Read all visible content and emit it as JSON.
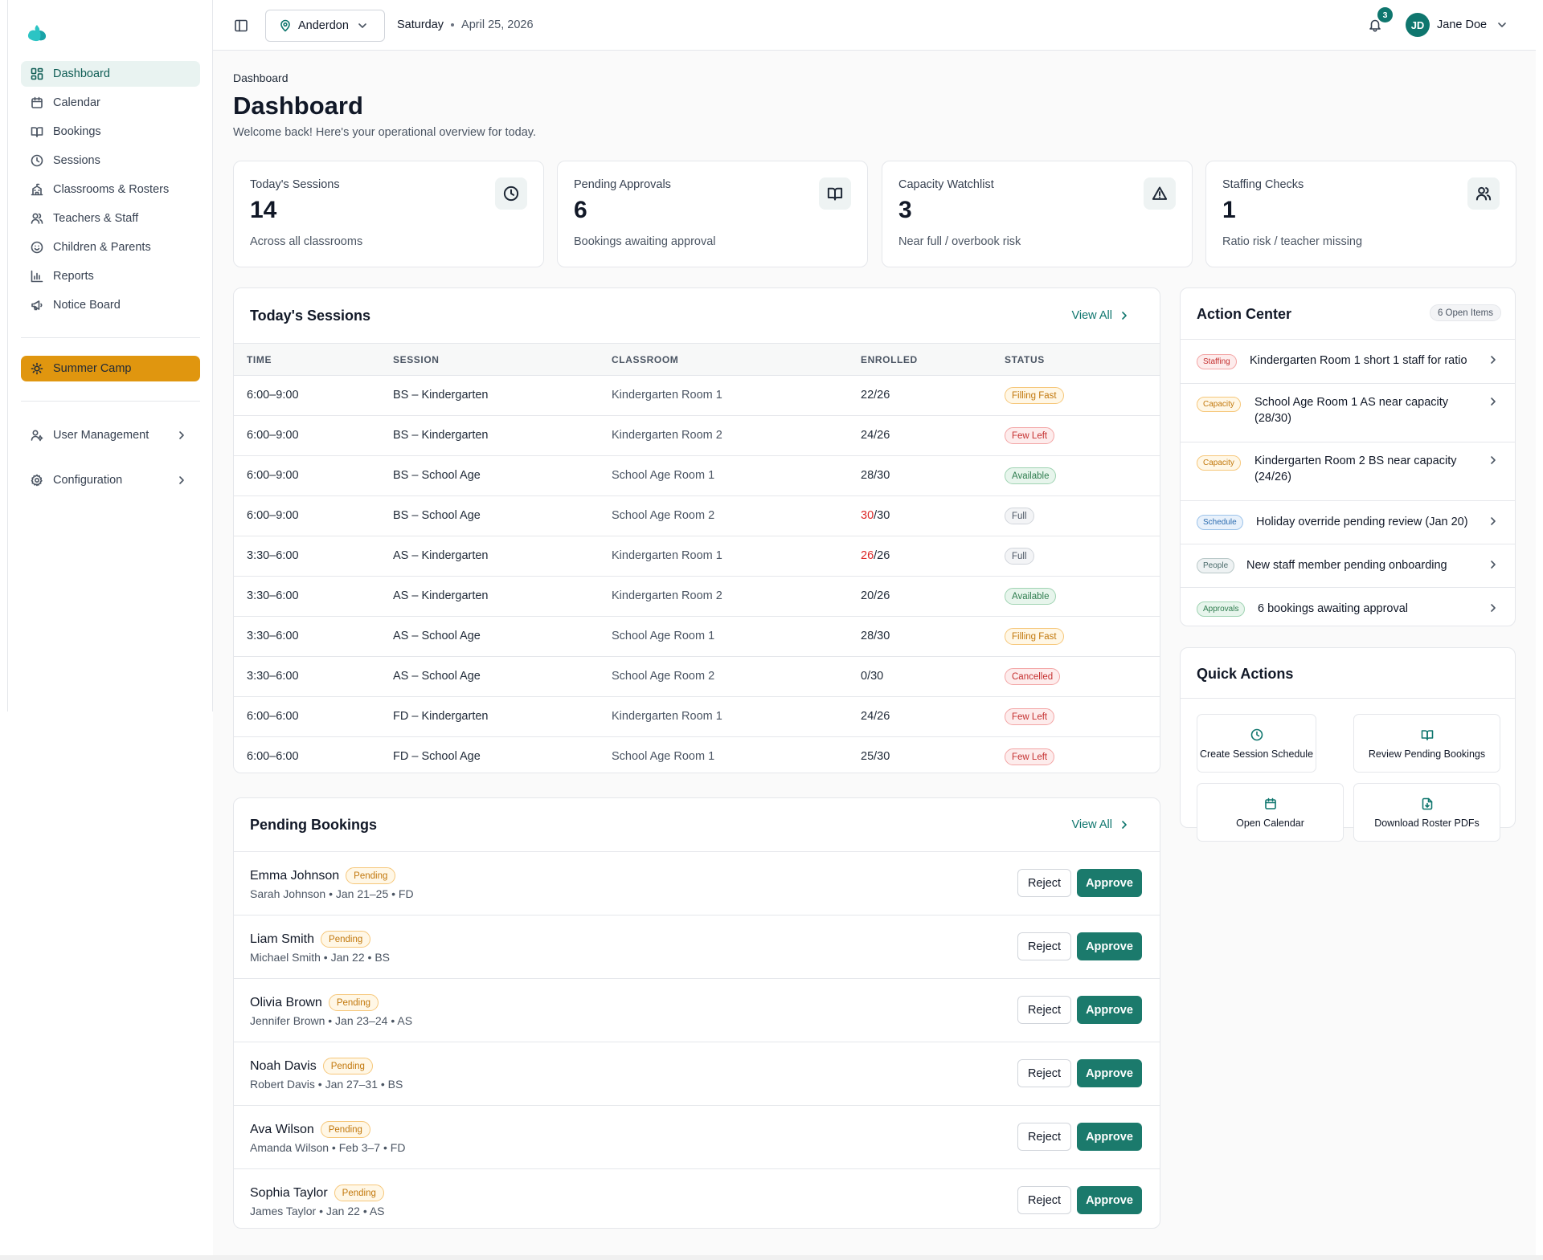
{
  "nav": {
    "items": [
      {
        "label": "Dashboard",
        "icon": "dashboard-icon"
      },
      {
        "label": "Calendar",
        "icon": "calendar-icon"
      },
      {
        "label": "Bookings",
        "icon": "book-icon"
      },
      {
        "label": "Sessions",
        "icon": "clock-icon"
      },
      {
        "label": "Classrooms & Rosters",
        "icon": "school-icon"
      },
      {
        "label": "Teachers & Staff",
        "icon": "users-icon"
      },
      {
        "label": "Children & Parents",
        "icon": "smile-icon"
      },
      {
        "label": "Reports",
        "icon": "bar-chart-icon"
      },
      {
        "label": "Notice Board",
        "icon": "megaphone-icon"
      }
    ],
    "program": "Summer Camp",
    "user_management": "User Management",
    "configuration": "Configuration"
  },
  "topbar": {
    "location": "Anderdon",
    "day": "Saturday",
    "date": "April 25, 2026",
    "notifications": "3",
    "initials": "JD",
    "user_name": "Jane Doe"
  },
  "page": {
    "breadcrumb": "Dashboard",
    "title": "Dashboard",
    "subtitle": "Welcome back! Here's your operational overview for today."
  },
  "stats": [
    {
      "label": "Today's Sessions",
      "value": "14",
      "hint": "Across all classrooms",
      "icon": "clock-icon"
    },
    {
      "label": "Pending Approvals",
      "value": "6",
      "hint": "Bookings awaiting approval",
      "icon": "book-icon"
    },
    {
      "label": "Capacity Watchlist",
      "value": "3",
      "hint": "Near full / overbook risk",
      "icon": "warning-icon"
    },
    {
      "label": "Staffing Checks",
      "value": "1",
      "hint": "Ratio risk / teacher missing",
      "icon": "users-icon"
    }
  ],
  "sessions": {
    "title": "Today's Sessions",
    "view_all": "View All",
    "columns": [
      "TIME",
      "SESSION",
      "CLASSROOM",
      "ENROLLED",
      "STATUS"
    ],
    "rows": [
      {
        "time": "6:00–9:00",
        "session": "BS – Kindergarten",
        "classroom": "Kindergarten Room 1",
        "enrolled": "22",
        "capacity": "/26",
        "status": "Filling Fast"
      },
      {
        "time": "6:00–9:00",
        "session": "BS – Kindergarten",
        "classroom": "Kindergarten Room 2",
        "enrolled": "24",
        "capacity": "/26",
        "status": "Few Left"
      },
      {
        "time": "6:00–9:00",
        "session": "BS – School Age",
        "classroom": "School Age Room 1",
        "enrolled": "28",
        "capacity": "/30",
        "status": "Available"
      },
      {
        "time": "6:00–9:00",
        "session": "BS – School Age",
        "classroom": "School Age Room 2",
        "enrolled": "30",
        "capacity": "/30",
        "status": "Full"
      },
      {
        "time": "3:30–6:00",
        "session": "AS – Kindergarten",
        "classroom": "Kindergarten Room 1",
        "enrolled": "26",
        "capacity": "/26",
        "status": "Full"
      },
      {
        "time": "3:30–6:00",
        "session": "AS – Kindergarten",
        "classroom": "Kindergarten Room 2",
        "enrolled": "20",
        "capacity": "/26",
        "status": "Available"
      },
      {
        "time": "3:30–6:00",
        "session": "AS – School Age",
        "classroom": "School Age Room 1",
        "enrolled": "28",
        "capacity": "/30",
        "status": "Filling Fast"
      },
      {
        "time": "3:30–6:00",
        "session": "AS – School Age",
        "classroom": "School Age Room 2",
        "enrolled": "0",
        "capacity": "/30",
        "status": "Cancelled"
      },
      {
        "time": "6:00–6:00",
        "session": "FD – Kindergarten",
        "classroom": "Kindergarten Room 1",
        "enrolled": "24",
        "capacity": "/26",
        "status": "Few Left"
      },
      {
        "time": "6:00–6:00",
        "session": "FD – School Age",
        "classroom": "School Age Room 1",
        "enrolled": "25",
        "capacity": "/30",
        "status": "Few Left"
      }
    ]
  },
  "bookings": {
    "title": "Pending Bookings",
    "view_all": "View All",
    "reject_label": "Reject",
    "approve_label": "Approve",
    "rows": [
      {
        "child": "Emma Johnson",
        "status": "Pending",
        "meta": "Sarah Johnson • Jan 21–25 • FD"
      },
      {
        "child": "Liam Smith",
        "status": "Pending",
        "meta": "Michael Smith • Jan 22 • BS"
      },
      {
        "child": "Olivia Brown",
        "status": "Pending",
        "meta": "Jennifer Brown • Jan 23–24 • AS"
      },
      {
        "child": "Noah Davis",
        "status": "Pending",
        "meta": "Robert Davis • Jan 27–31 • BS"
      },
      {
        "child": "Ava Wilson",
        "status": "Pending",
        "meta": "Amanda Wilson • Feb 3–7 • FD"
      },
      {
        "child": "Sophia Taylor",
        "status": "Pending",
        "meta": "James Taylor • Jan 22 • AS"
      }
    ]
  },
  "action_center": {
    "title": "Action Center",
    "count": "6 Open Items",
    "items": [
      {
        "tag": "Staffing",
        "text": "Kindergarten Room 1 short 1 staff for ratio"
      },
      {
        "tag": "Capacity",
        "text": "School Age Room 1 AS near capacity (28/30)"
      },
      {
        "tag": "Capacity",
        "text": "Kindergarten Room 2 BS near capacity (24/26)"
      },
      {
        "tag": "Schedule",
        "text": "Holiday override pending review (Jan 20)"
      },
      {
        "tag": "People",
        "text": "New staff member pending onboarding"
      },
      {
        "tag": "Approvals",
        "text": "6 bookings awaiting approval"
      }
    ]
  },
  "quick_actions": {
    "title": "Quick Actions",
    "items": [
      {
        "label": "Create Session Schedule",
        "icon": "clock-icon"
      },
      {
        "label": "Review Pending Bookings",
        "icon": "book-icon"
      },
      {
        "label": "Open Calendar",
        "icon": "calendar-icon"
      },
      {
        "label": "Download Roster PDFs",
        "icon": "file-download-icon"
      }
    ]
  },
  "colors": {
    "brand": "#0f766e",
    "approve": "#1b7a6c",
    "program_highlight": "#e0960f",
    "alert_red": "#dc2626"
  }
}
